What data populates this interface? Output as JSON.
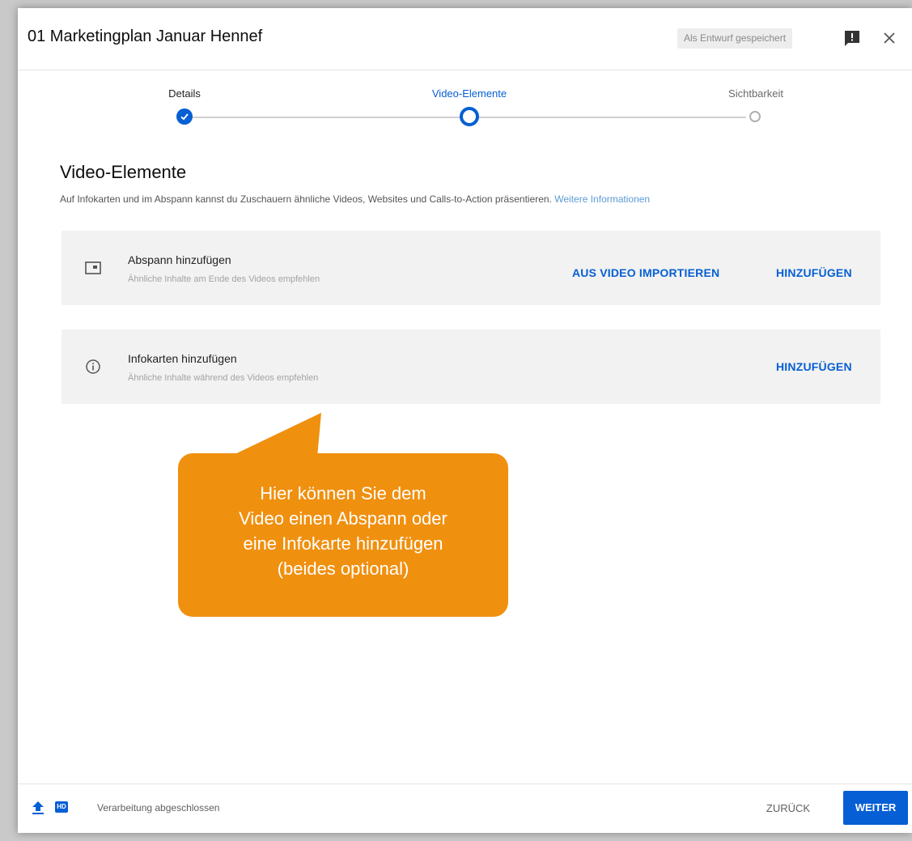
{
  "header": {
    "title": "01 Marketingplan Januar Hennef",
    "saved_badge": "Als Entwurf gespeichert",
    "feedback_icon": "feedback-icon",
    "close_icon": "close-icon"
  },
  "stepper": {
    "steps": [
      {
        "label": "Details",
        "state": "done"
      },
      {
        "label": "Video-Elemente",
        "state": "active"
      },
      {
        "label": "Sichtbarkeit",
        "state": "todo"
      }
    ]
  },
  "section": {
    "title": "Video-Elemente",
    "description": "Auf Infokarten und im Abspann kannst du Zuschauern ähnliche Videos, Websites und Calls-to-Action präsentieren.",
    "link": "Weitere Informationen"
  },
  "cards": [
    {
      "icon": "end-screen-icon",
      "title": "Abspann hinzufügen",
      "subtitle": "Ähnliche Inhalte am Ende des Videos empfehlen",
      "import_label": "AUS VIDEO IMPORTIEREN",
      "add_label": "HINZUFÜGEN"
    },
    {
      "icon": "info-icon",
      "title": "Infokarten hinzufügen",
      "subtitle": "Ähnliche Inhalte während des Videos empfehlen",
      "add_label": "HINZUFÜGEN"
    }
  ],
  "callout": {
    "line1": "Hier können Sie dem",
    "line2": "Video einen Abspann oder",
    "line3": "eine Infokarte hinzufügen",
    "line4": "(beides optional)"
  },
  "footer": {
    "hd_label": "HD",
    "status": "Verarbeitung abgeschlossen",
    "back_label": "ZURÜCK",
    "next_label": "WEITER"
  },
  "colors": {
    "accent": "#065fd4",
    "callout": "#f0900f"
  }
}
